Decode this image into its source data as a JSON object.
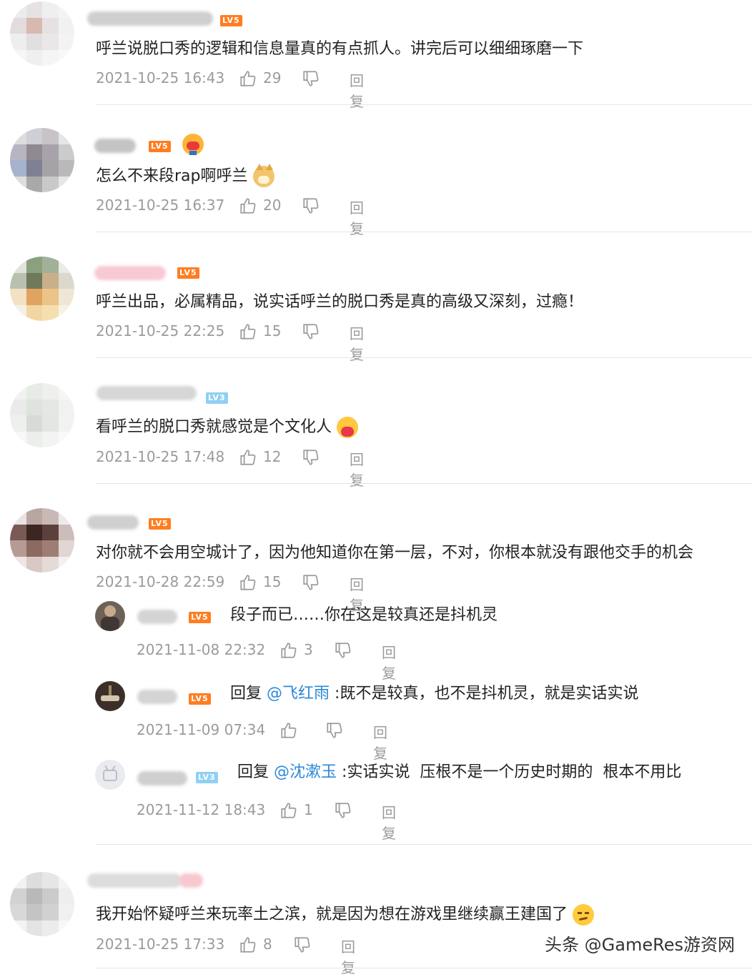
{
  "ui": {
    "reply_label": "回复",
    "level_5": "LV5",
    "level_3": "LV3"
  },
  "comments": [
    {
      "text": "呼兰说脱口秀的逻辑和信息量真的有点抓人。讲完后可以细细琢磨一下",
      "time": "2021-10-25 16:43",
      "likes": "29"
    },
    {
      "text": "怎么不来段rap啊呼兰",
      "time": "2021-10-25 16:37",
      "likes": "20"
    },
    {
      "text": "呼兰出品，必属精品，说实话呼兰的脱口秀是真的高级又深刻，过瘾！",
      "time": "2021-10-25 22:25",
      "likes": "15"
    },
    {
      "text": "看呼兰的脱口秀就感觉是个文化人",
      "time": "2021-10-25 17:48",
      "likes": "12"
    },
    {
      "text": "对你就不会用空城计了，因为他知道你在第一层，不对，你根本就没有跟他交手的机会",
      "time": "2021-10-28 22:59",
      "likes": "15"
    },
    {
      "text": "我开始怀疑呼兰来玩率土之滨，就是因为想在游戏里继续赢王建国了",
      "time": "2021-10-25 17:33",
      "likes": "8"
    }
  ],
  "replies": [
    {
      "text": "段子而已……你在这是较真还是抖机灵",
      "time": "2021-11-08 22:32",
      "likes": "3"
    },
    {
      "prefix": "回复",
      "mention": "@飞红雨",
      "text": ":既不是较真，也不是抖机灵，就是实话实说",
      "time": "2021-11-09 07:34",
      "likes": ""
    },
    {
      "prefix": "回复",
      "mention": "@沈漱玉",
      "text": ":实话实说  压根不是一个历史时期的  根本不用比",
      "time": "2021-11-12 18:43",
      "likes": "1"
    }
  ],
  "watermark": "头条 @GameRes游资网",
  "colors": {
    "level_badge": "#ff7d21",
    "level_badge_low": "#8fd0f3",
    "mention": "#2d88d8",
    "meta": "#9b9b9b"
  },
  "icons": {
    "like": "thumbs-up-icon",
    "dislike": "thumbs-down-icon"
  }
}
